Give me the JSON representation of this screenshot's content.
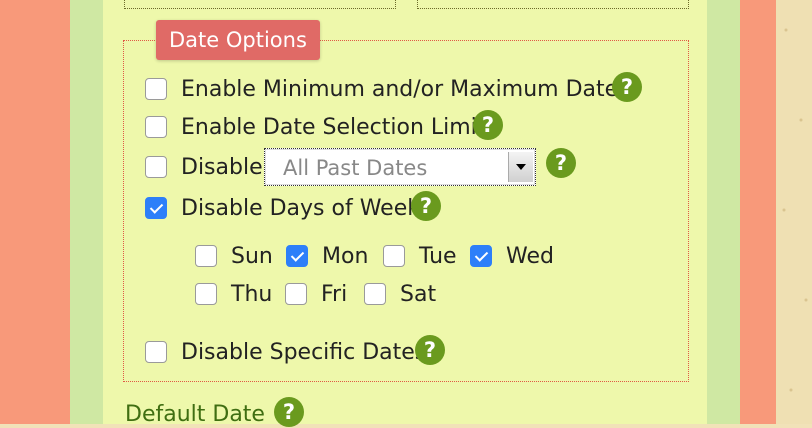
{
  "legend": "Date Options",
  "options": {
    "min_max": {
      "label": "Enable Minimum and/or Maximum Dates",
      "checked": false
    },
    "selection_limit": {
      "label": "Enable Date Selection Limit",
      "checked": false
    },
    "disable": {
      "label": "Disable",
      "checked": false,
      "select_value": "All Past Dates"
    },
    "days_of_week": {
      "label": "Disable Days of Week",
      "checked": true
    },
    "specific_dates": {
      "label": "Disable Specific Dates",
      "checked": false
    }
  },
  "days": [
    {
      "label": "Sun",
      "checked": false
    },
    {
      "label": "Mon",
      "checked": true
    },
    {
      "label": "Tue",
      "checked": false
    },
    {
      "label": "Wed",
      "checked": true
    },
    {
      "label": "Thu",
      "checked": false
    },
    {
      "label": "Fri",
      "checked": false
    },
    {
      "label": "Sat",
      "checked": false
    }
  ],
  "help_symbol": "?",
  "default_date_heading": "Default Date",
  "colors": {
    "legend_bg": "#e06a66",
    "help_bg": "#6a9a1e",
    "checked": "#2d7ff9",
    "panel_bg": "#eef8ab"
  }
}
